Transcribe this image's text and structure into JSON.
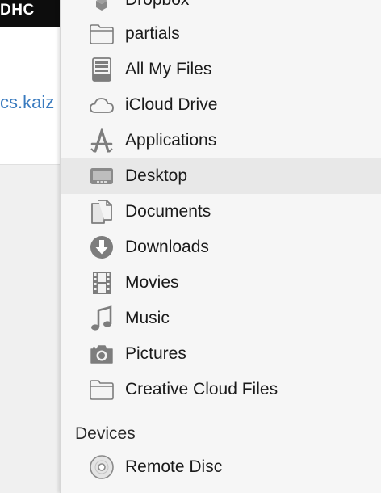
{
  "background_window": {
    "title_fragment": "DHC",
    "link_fragment": "cs.kaiz"
  },
  "sidebar": {
    "items": [
      {
        "label": "Dropbox",
        "icon": "dropbox-icon"
      },
      {
        "label": "partials",
        "icon": "folder-icon"
      },
      {
        "label": "All My Files",
        "icon": "all-my-files-icon"
      },
      {
        "label": "iCloud Drive",
        "icon": "icloud-icon"
      },
      {
        "label": "Applications",
        "icon": "applications-icon"
      },
      {
        "label": "Desktop",
        "icon": "desktop-icon",
        "selected": true
      },
      {
        "label": "Documents",
        "icon": "documents-icon"
      },
      {
        "label": "Downloads",
        "icon": "downloads-icon"
      },
      {
        "label": "Movies",
        "icon": "movies-icon"
      },
      {
        "label": "Music",
        "icon": "music-icon"
      },
      {
        "label": "Pictures",
        "icon": "pictures-icon"
      },
      {
        "label": "Creative Cloud Files",
        "icon": "folder-icon"
      }
    ],
    "devices_header": "Devices",
    "devices": [
      {
        "label": "Remote Disc",
        "icon": "remote-disc-icon"
      }
    ]
  },
  "colors": {
    "icon_gray": "#7d7d7d",
    "selected_row": "#e8e8e8",
    "link_blue": "#3a7bbf"
  }
}
